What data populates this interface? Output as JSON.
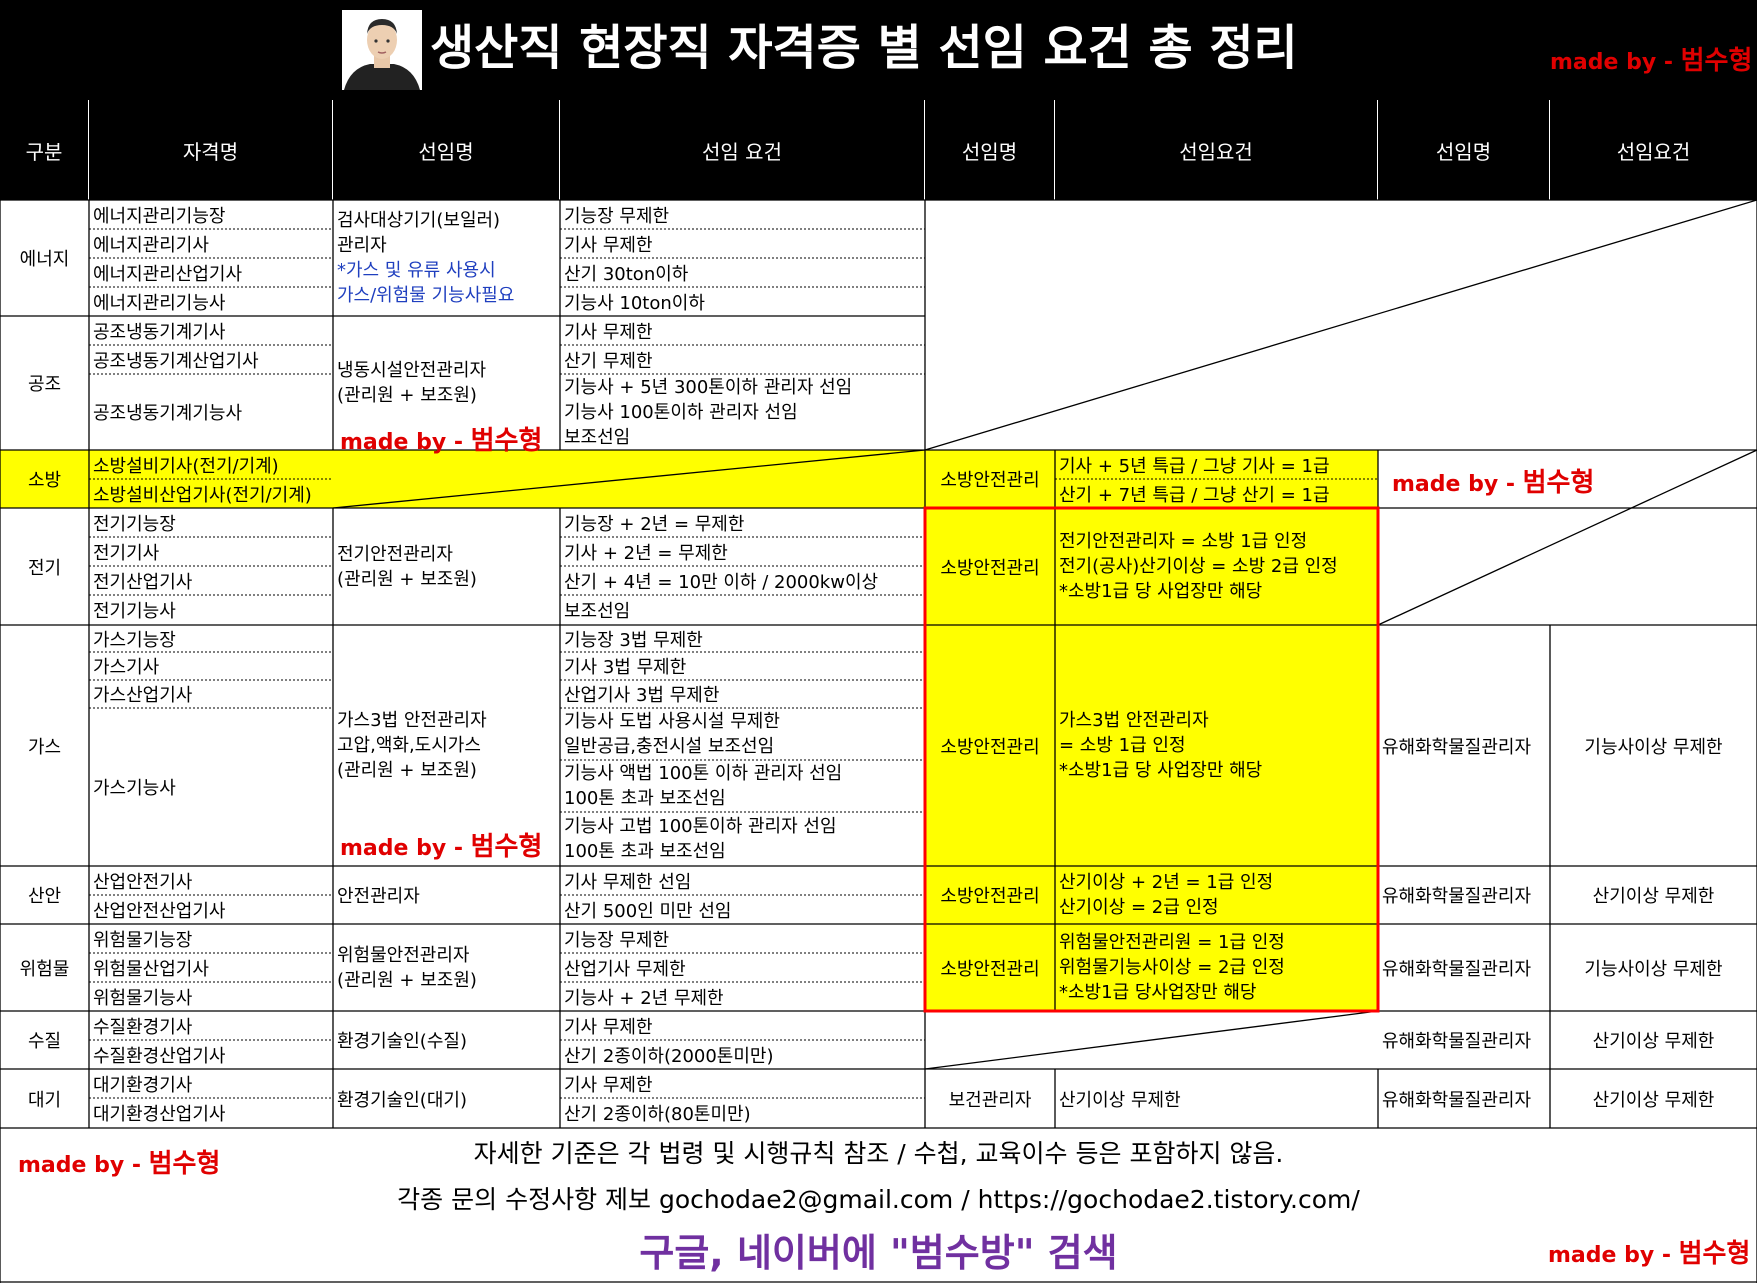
{
  "title": "생산직 현장직 자격증 별 선임 요건 총 정리",
  "watermark": "made by - ",
  "watermark_name": "범수형",
  "headers": [
    "구분",
    "자격명",
    "선임명",
    "선임 요건",
    "선임명",
    "선임요건",
    "선임명",
    "선임요건"
  ],
  "rows": {
    "energy": {
      "category": "에너지",
      "quals": [
        "에너지관리기능장",
        "에너지관리기사",
        "에너지관리산업기사",
        "에너지관리기능사"
      ],
      "position_lines": [
        "검사대상기기(보일러)",
        "관리자"
      ],
      "position_note_lines": [
        "*가스 및 유류 사용시",
        "가스/위험물 기능사필요"
      ],
      "reqs": [
        "기능장 무제한",
        "기사 무제한",
        "산기 30ton이하",
        "기능사 10ton이하"
      ]
    },
    "hvac": {
      "category": "공조",
      "quals": [
        "공조냉동기계기사",
        "공조냉동기계산업기사",
        "공조냉동기계기능사"
      ],
      "position_lines": [
        "냉동시설안전관리자",
        "(관리원 + 보조원)"
      ],
      "reqs": [
        "기사 무제한",
        "산기 무제한",
        "기능사 + 5년 300톤이하 관리자 선임",
        "기능사 100톤이하 관리자 선임",
        "보조선임"
      ]
    },
    "fire": {
      "category": "소방",
      "quals": [
        "소방설비기사(전기/기계)",
        "소방설비산업기사(전기/기계)"
      ],
      "fire_position": "소방안전관리",
      "fire_reqs": [
        "기사 + 5년 특급 / 그냥 기사 = 1급",
        "산기 + 7년 특급 / 그냥 산기 = 1급"
      ]
    },
    "elec": {
      "category": "전기",
      "quals": [
        "전기기능장",
        "전기기사",
        "전기산업기사",
        "전기기능사"
      ],
      "position_lines": [
        "전기안전관리자",
        "(관리원 + 보조원)"
      ],
      "reqs": [
        "기능장 + 2년 = 무제한",
        "기사 + 2년 = 무제한",
        "산기 + 4년 = 10만 이하 / 2000kw이상",
        "보조선임"
      ],
      "fire_position": "소방안전관리",
      "fire_req_lines": [
        "전기안전관리자 = 소방 1급 인정",
        "전기(공사)산기이상 = 소방 2급 인정",
        "*소방1급 당 사업장만 해당"
      ]
    },
    "gas": {
      "category": "가스",
      "quals": [
        "가스기능장",
        "가스기사",
        "가스산업기사",
        "가스기능사"
      ],
      "position_lines": [
        "가스3법 안전관리자",
        "고압,액화,도시가스",
        "(관리원 + 보조원)"
      ],
      "reqs": [
        "기능장 3법 무제한",
        "기사 3법 무제한",
        "산업기사 3법 무제한"
      ],
      "req_groups": [
        [
          "기능사 도법 사용시설 무제한",
          "일반공급,충전시설 보조선임"
        ],
        [
          "기능사 액법 100톤 이하 관리자 선임",
          "100톤 초과 보조선임"
        ],
        [
          "기능사 고법 100톤이하 관리자 선임",
          "100톤 초과 보조선임"
        ]
      ],
      "fire_position": "소방안전관리",
      "fire_req_lines": [
        "가스3법 안전관리자",
        "= 소방 1급 인정",
        "*소방1급 당 사업장만 해당"
      ],
      "chem_position": "유해화학물질관리자",
      "chem_req": "기능사이상 무제한"
    },
    "safety": {
      "category": "산안",
      "quals": [
        "산업안전기사",
        "산업안전산업기사"
      ],
      "position": "안전관리자",
      "reqs": [
        "기사 무제한 선임",
        "산기 500인 미만 선임"
      ],
      "fire_position": "소방안전관리",
      "fire_req_lines": [
        "산기이상 + 2년 = 1급 인정",
        "산기이상 = 2급 인정"
      ],
      "chem_position": "유해화학물질관리자",
      "chem_req": "산기이상 무제한"
    },
    "hazmat": {
      "category": "위험물",
      "quals": [
        "위험물기능장",
        "위험물산업기사",
        "위험물기능사"
      ],
      "position_lines": [
        "위험물안전관리자",
        "(관리원 + 보조원)"
      ],
      "reqs": [
        "기능장 무제한",
        "산업기사 무제한",
        "기능사 + 2년 무제한"
      ],
      "fire_position": "소방안전관리",
      "fire_req_lines": [
        "위험물안전관리원 = 1급 인정",
        "위험물기능사이상 = 2급 인정",
        "*소방1급 당사업장만 해당"
      ],
      "chem_position": "유해화학물질관리자",
      "chem_req": "기능사이상 무제한"
    },
    "water": {
      "category": "수질",
      "quals": [
        "수질환경기사",
        "수질환경산업기사"
      ],
      "position": "환경기술인(수질)",
      "reqs": [
        "기사 무제한",
        "산기 2종이하(2000톤미만)"
      ],
      "chem_position": "유해화학물질관리자",
      "chem_req": "산기이상 무제한"
    },
    "air": {
      "category": "대기",
      "quals": [
        "대기환경기사",
        "대기환경산업기사"
      ],
      "position": "환경기술인(대기)",
      "reqs": [
        "기사 무제한",
        "산기 2종이하(80톤미만)"
      ],
      "health_position": "보건관리자",
      "health_req": "산기이상 무제한",
      "chem_position": "유해화학물질관리자",
      "chem_req": "산기이상 무제한"
    }
  },
  "footer": {
    "line1": "자세한 기준은 각 법령 및 시행규칙 참조 / 수첩, 교육이수 등은 포함하지 않음.",
    "line2": "각종 문의 수정사항 제보 gochodae2@gmail.com / https://gochodae2.tistory.com/",
    "line3": "구글, 네이버에 \"범수방\" 검색"
  },
  "colors": {
    "highlight": "#ffff00",
    "header_bg": "#000000",
    "note_blue": "#1f3fbf",
    "watermark_red": "#e00000",
    "footer_purple": "#7030a0",
    "box_red": "#ff0000"
  }
}
